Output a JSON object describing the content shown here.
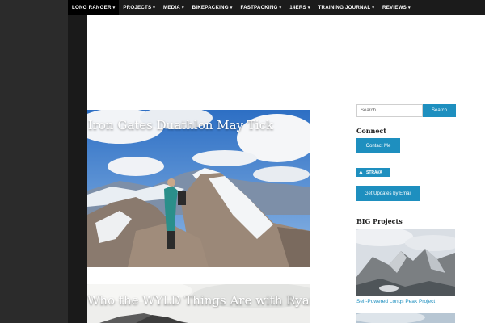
{
  "nav": {
    "items": [
      {
        "label": "LONG RANGER",
        "active": true
      },
      {
        "label": "PROJECTS",
        "active": false
      },
      {
        "label": "MEDIA",
        "active": false
      },
      {
        "label": "BIKEPACKING",
        "active": false
      },
      {
        "label": "FASTPACKING",
        "active": false
      },
      {
        "label": "14ERS",
        "active": false
      },
      {
        "label": "TRAINING JOURNAL",
        "active": false
      },
      {
        "label": "REVIEWS",
        "active": false
      }
    ],
    "chevron_icon": "chevron-down-icon"
  },
  "posts": [
    {
      "title": "ak Iron Gates Duathlon May Tick"
    },
    {
      "title": "Who the WYLD Things Are with Ryan"
    }
  ],
  "sidebar": {
    "search": {
      "placeholder": "Search",
      "button": "Search"
    },
    "connect": {
      "title": "Connect",
      "contact_button": "Contact Me"
    },
    "strava": {
      "label": "STRAVA",
      "icon": "strava-icon"
    },
    "updates_button": "Get Updates by Email",
    "projects": {
      "title": "BIG Projects",
      "link": "Self-Powered Longs Peak Project"
    }
  },
  "colors": {
    "accent": "#1e8fbf",
    "nav_bg": "#1b1b1b",
    "left_panel": "#2b2b2b"
  }
}
